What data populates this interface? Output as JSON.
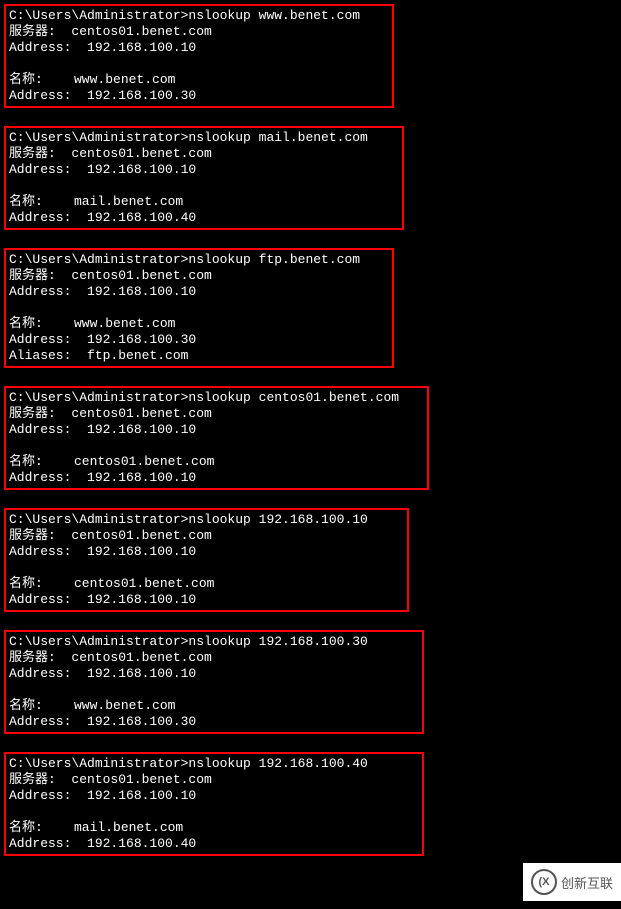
{
  "queries": [
    {
      "prompt_line": "C:\\Users\\Administrator>nslookup www.benet.com",
      "server_label": "服务器:  centos01.benet.com",
      "server_addr": "Address:  192.168.100.10",
      "name_label": "名称:    www.benet.com",
      "name_addr": "Address:  192.168.100.30",
      "aliases": null
    },
    {
      "prompt_line": "C:\\Users\\Administrator>nslookup mail.benet.com",
      "server_label": "服务器:  centos01.benet.com",
      "server_addr": "Address:  192.168.100.10",
      "name_label": "名称:    mail.benet.com",
      "name_addr": "Address:  192.168.100.40",
      "aliases": null
    },
    {
      "prompt_line": "C:\\Users\\Administrator>nslookup ftp.benet.com",
      "server_label": "服务器:  centos01.benet.com",
      "server_addr": "Address:  192.168.100.10",
      "name_label": "名称:    www.benet.com",
      "name_addr": "Address:  192.168.100.30",
      "aliases": "Aliases:  ftp.benet.com"
    },
    {
      "prompt_line": "C:\\Users\\Administrator>nslookup centos01.benet.com",
      "server_label": "服务器:  centos01.benet.com",
      "server_addr": "Address:  192.168.100.10",
      "name_label": "名称:    centos01.benet.com",
      "name_addr": "Address:  192.168.100.10",
      "aliases": null
    },
    {
      "prompt_line": "C:\\Users\\Administrator>nslookup 192.168.100.10",
      "server_label": "服务器:  centos01.benet.com",
      "server_addr": "Address:  192.168.100.10",
      "name_label": "名称:    centos01.benet.com",
      "name_addr": "Address:  192.168.100.10",
      "aliases": null
    },
    {
      "prompt_line": "C:\\Users\\Administrator>nslookup 192.168.100.30",
      "server_label": "服务器:  centos01.benet.com",
      "server_addr": "Address:  192.168.100.10",
      "name_label": "名称:    www.benet.com",
      "name_addr": "Address:  192.168.100.30",
      "aliases": null
    },
    {
      "prompt_line": "C:\\Users\\Administrator>nslookup 192.168.100.40",
      "server_label": "服务器:  centos01.benet.com",
      "server_addr": "Address:  192.168.100.10",
      "name_label": "名称:    mail.benet.com",
      "name_addr": "Address:  192.168.100.40",
      "aliases": null
    }
  ],
  "watermark": {
    "text": "创新互联",
    "icon_text": "(X"
  }
}
